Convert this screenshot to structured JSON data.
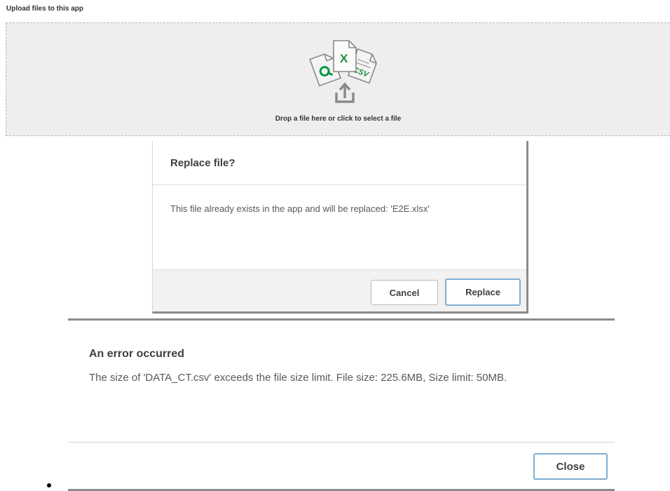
{
  "upload": {
    "title": "Upload files to this app",
    "drop_text": "Drop a file here or click to select a file",
    "file_icons": {
      "excel_label": "X",
      "csv_label": "CSV"
    }
  },
  "replace_dialog": {
    "title": "Replace file?",
    "message": "This file already exists in the app and will be replaced: 'E2E.xlsx'",
    "cancel_label": "Cancel",
    "replace_label": "Replace"
  },
  "error_dialog": {
    "title": "An error occurred",
    "message": "The size of 'DATA_CT.csv' exceeds the file size limit. File size: 225.6MB, Size limit: 50MB.",
    "close_label": "Close"
  },
  "colors": {
    "qlik_green": "#009845",
    "excel_green": "#1d8f3a",
    "icon_gray": "#8a8a8a",
    "button_focus_border": "#7daed5"
  },
  "icons": [
    "qlik-file-icon",
    "excel-file-icon",
    "csv-file-icon",
    "upload-arrow-icon"
  ]
}
